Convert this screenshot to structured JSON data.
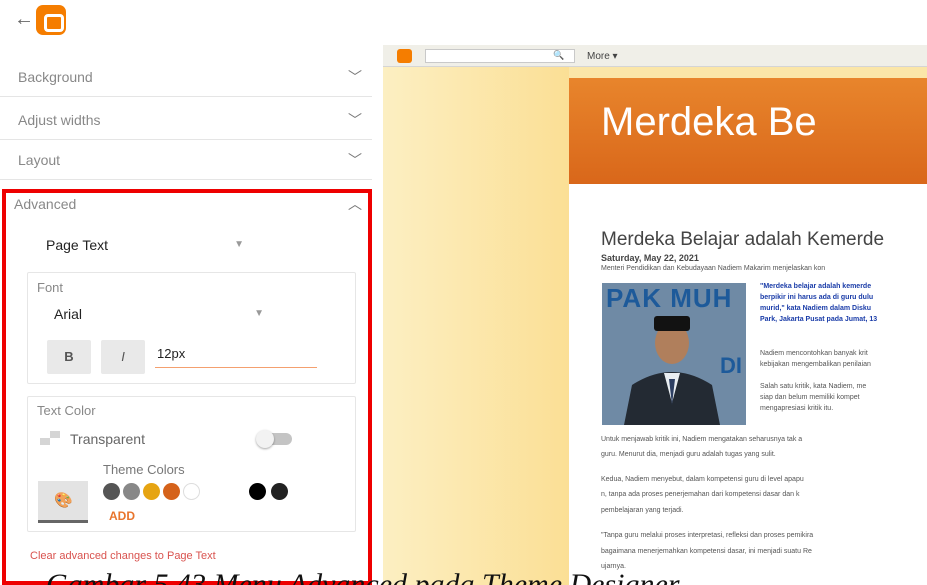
{
  "panel": {
    "sections": [
      {
        "label": "Background"
      },
      {
        "label": "Adjust widths"
      },
      {
        "label": "Layout"
      }
    ],
    "advanced": {
      "label": "Advanced",
      "element_select": "Page Text",
      "font": {
        "title": "Font",
        "family": "Arial",
        "bold_label": "B",
        "italic_label": "I",
        "size": "12px"
      },
      "text_color": {
        "title": "Text Color",
        "transparent_label": "Transparent",
        "transparent_enabled": false,
        "theme_colors_label": "Theme Colors",
        "swatches": [
          "#555555",
          "#888888",
          "#e6a412",
          "#d5621a",
          "#ffffff",
          "#000000",
          "#222222"
        ],
        "add_label": "ADD"
      },
      "clear_link": "Clear advanced changes to Page Text"
    }
  },
  "preview": {
    "navbar_more": "More ▾",
    "blog_title": "Merdeka Be",
    "post_date": "Saturday, May 22, 2021",
    "post_title": "Merdeka Belajar adalah Kemerde",
    "intro": "Menteri Pendidikan dan Kebudayaan Nadiem Makarim menjelaskan kon",
    "photo_text": "PAK MUH",
    "photo_text_2": "DI",
    "quote_lines": [
      "\"Merdeka belajar adalah kemerde",
      "berpikir ini harus ada di guru dulu",
      "murid,\" kata Nadiem dalam Disku",
      "Park, Jakarta Pusat pada Jumat, 13"
    ],
    "side_lines": [
      "Nadiem mencontohkan banyak krit",
      "kebijakan mengembalikan penilaian",
      "",
      "Salah satu kritik, kata Nadiem, me",
      "siap dan belum memiliki kompet",
      "mengapresiasi kritik itu."
    ],
    "body_lines": [
      "Untuk menjawab kritik ini, Nadiem mengatakan seharusnya tak a",
      "guru. Menurut dia, menjadi guru adalah tugas yang sulit.",
      "Kedua, Nadiem menyebut, dalam kompetensi guru di level apapu",
      "n, tanpa ada proses penerjemahan dari kompetensi dasar dan k",
      "pembelajaran yang terjadi.",
      "\"Tanpa guru melalui proses interpretasi, refleksi dan proses pemikira",
      "bagaimana menerjemahkan kompetensi dasar, ini menjadi suatu Re",
      "ujarnya."
    ]
  },
  "caption": "Gambar 5.43 Menu Advanced pada Theme Designer"
}
